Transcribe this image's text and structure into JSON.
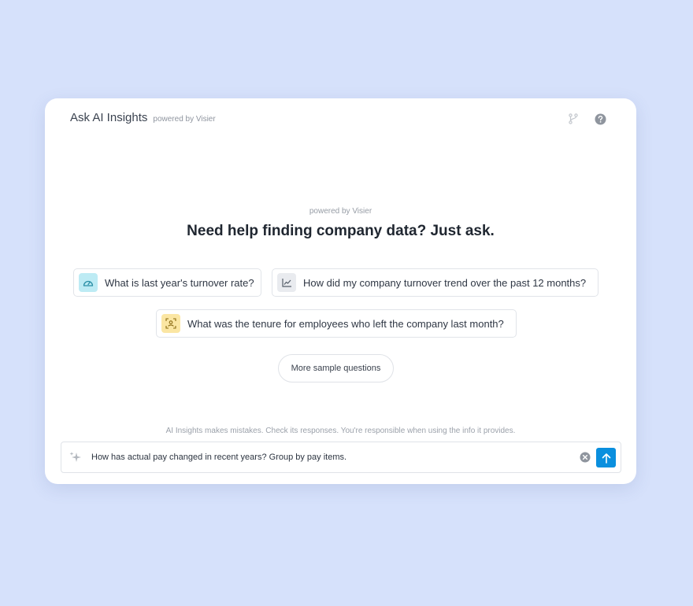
{
  "header": {
    "title": "Ask AI Insights",
    "subtitle": "powered by Visier",
    "icons": [
      "branch-icon",
      "help-icon"
    ]
  },
  "hero": {
    "powered_by": "powered by Visier",
    "headline": "Need help finding company data? Just ask."
  },
  "suggestions": [
    {
      "icon": "gauge-icon",
      "color": "#bdebf4",
      "label": "What is last year's turnover rate?"
    },
    {
      "icon": "line-chart-icon",
      "color": "#e9ebef",
      "label": "How did my company turnover trend over the past 12 months?"
    },
    {
      "icon": "person-focus-icon",
      "color": "#fbe6a3",
      "label": "What was the tenure for employees who left the company last month?"
    }
  ],
  "more_button": "More sample questions",
  "disclaimer": "AI Insights makes mistakes. Check its responses. You're responsible when using the info it provides.",
  "input": {
    "value": "How has actual pay changed in recent years? Group by pay items.",
    "icon": "sparkle-icon"
  },
  "colors": {
    "background": "#d6e1fb",
    "accent": "#0a8fde"
  }
}
